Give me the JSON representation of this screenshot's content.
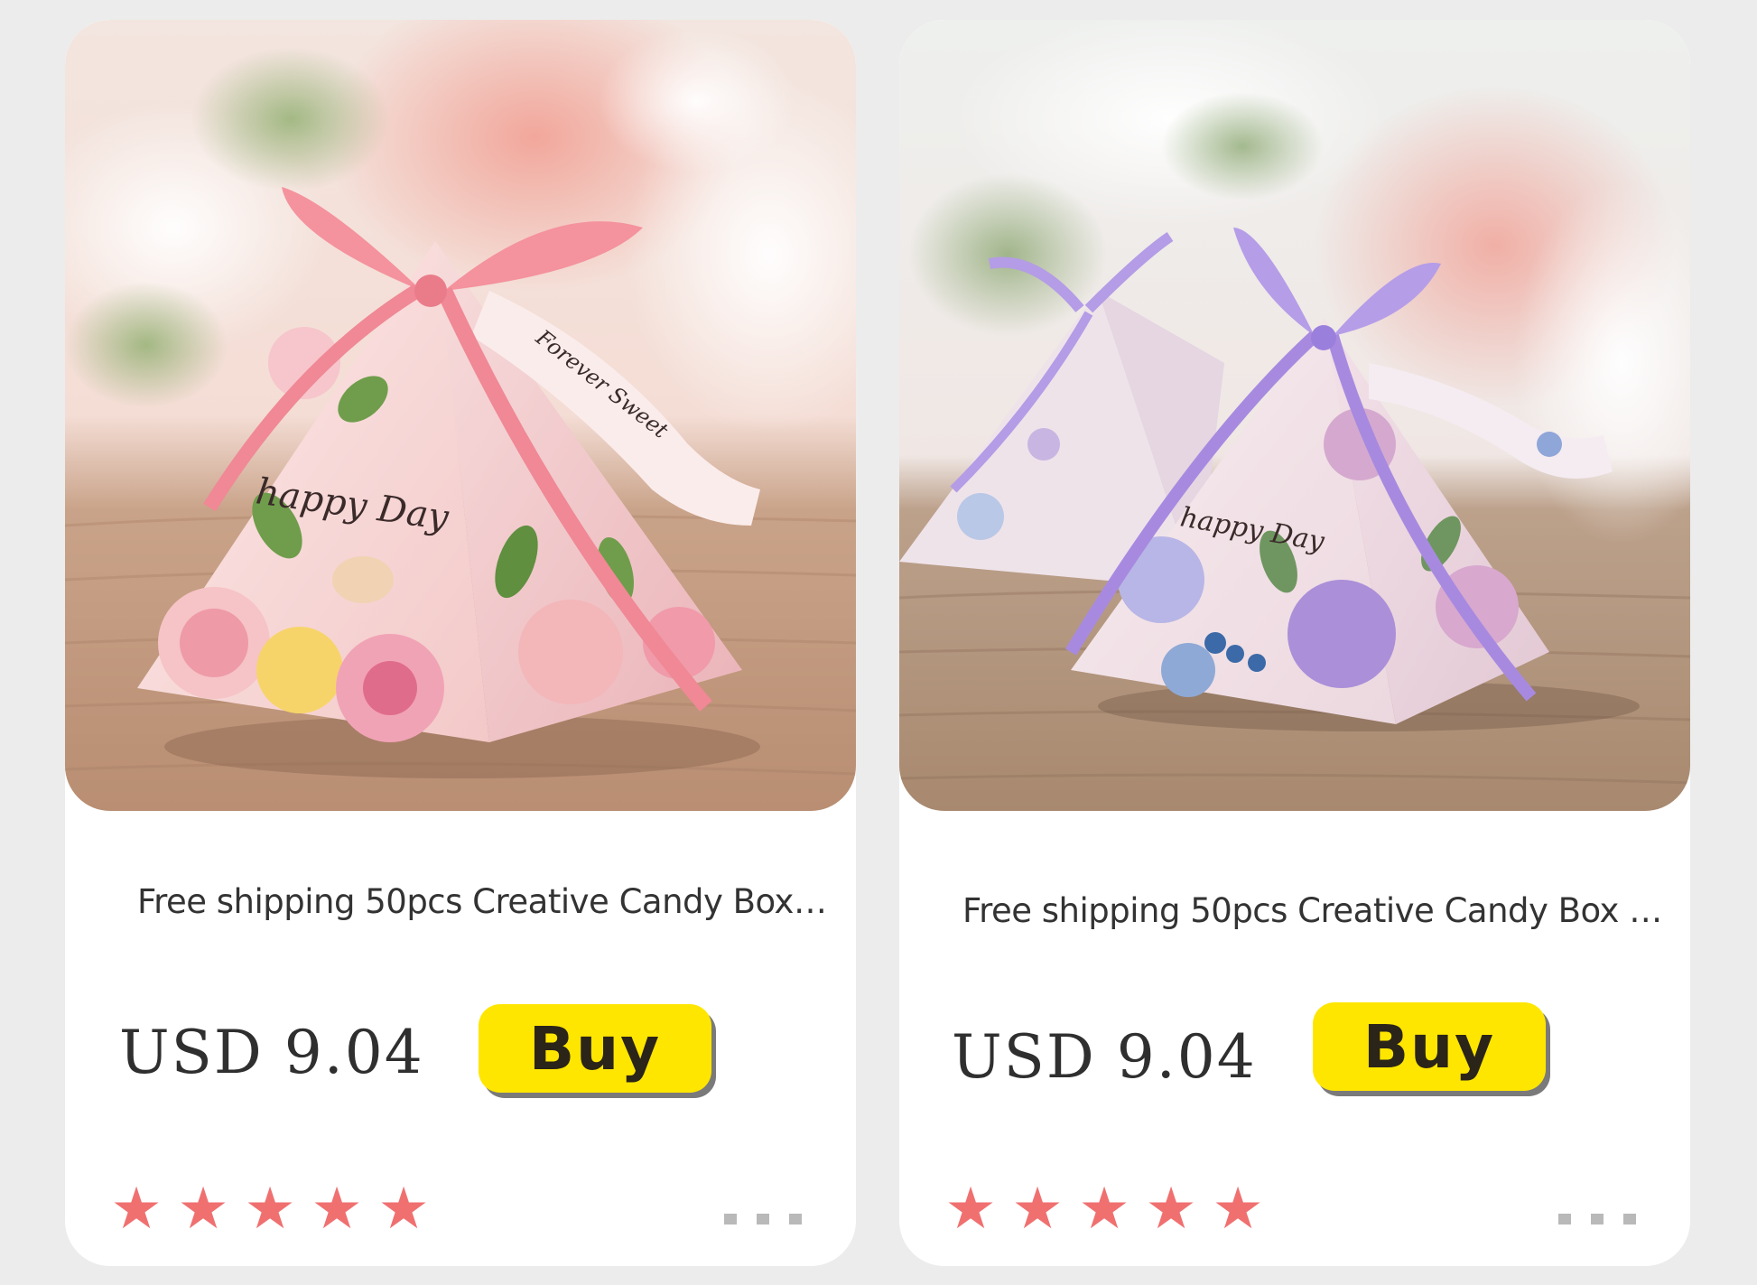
{
  "products": [
    {
      "title": "Free shipping 50pcs Creative Candy Box…",
      "price": "USD 9.04",
      "buy_label": "Buy",
      "rating": 5,
      "image_alt": "Pink floral pyramid candy box with pink ribbon, \"happy Day\"",
      "box_print_main": "happy Day",
      "box_print_tag": "Forever Sweet",
      "accent_color": "#f09aa8"
    },
    {
      "title": "Free shipping 50pcs Creative Candy Box …",
      "price": "USD 9.04",
      "buy_label": "Buy",
      "rating": 5,
      "image_alt": "Lavender floral pyramid candy box with purple ribbon, \"happy Day\"",
      "box_print_main": "happy Day",
      "accent_color": "#a98ae0"
    }
  ],
  "colors": {
    "background": "#ececec",
    "card": "#ffffff",
    "buy_button": "#ffe600",
    "star": "#f07070",
    "dots": "#b9b9b9",
    "price_text": "#2f2f2f"
  },
  "icons": {
    "star": "star-icon",
    "more": "more-dots-icon"
  }
}
